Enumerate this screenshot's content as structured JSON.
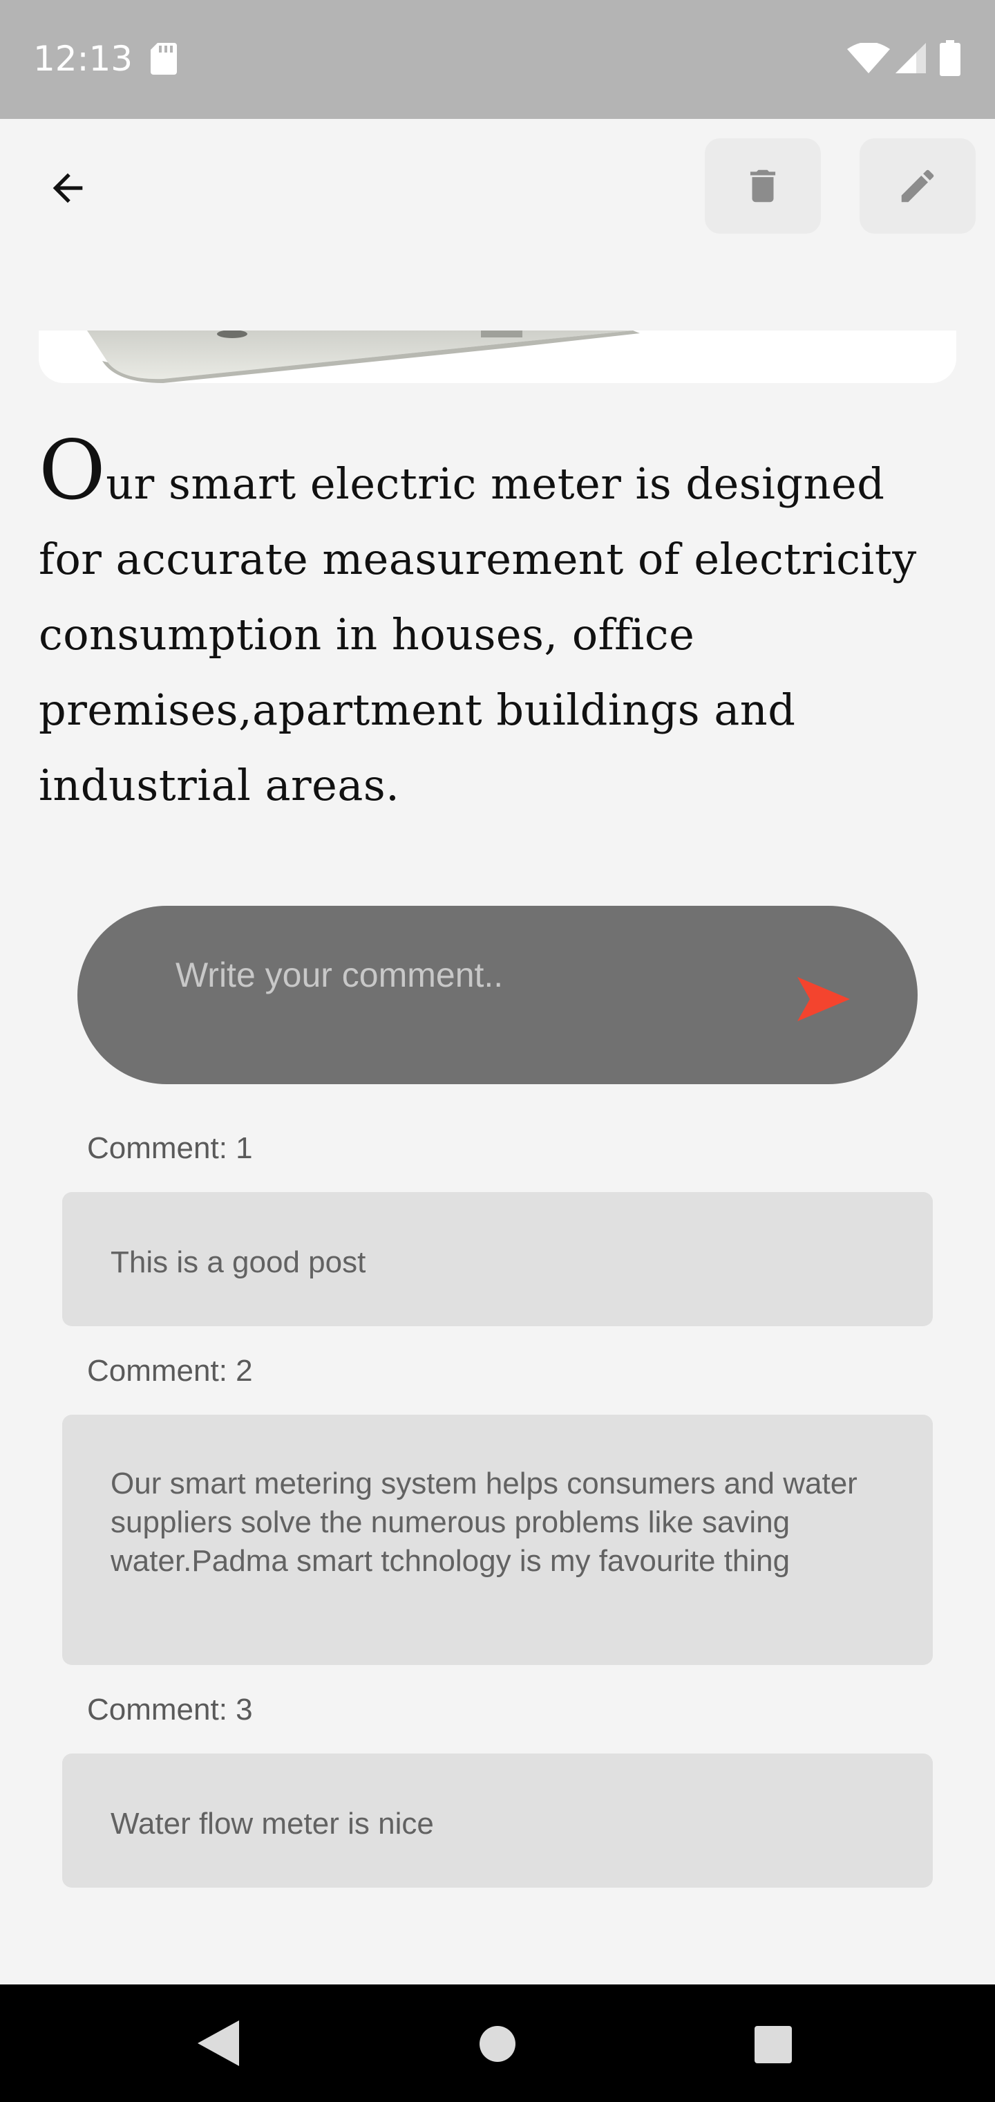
{
  "status_bar": {
    "time": "12:13",
    "icons": [
      "sd-card-icon",
      "wifi-icon",
      "signal-icon",
      "battery-icon"
    ]
  },
  "app_bar": {
    "back_icon": "arrow-back-icon",
    "delete_icon": "trash-icon",
    "edit_icon": "pencil-icon"
  },
  "post": {
    "description_first_letter": "O",
    "description_rest": "ur smart electric meter is designed for accurate measurement of electricity consumption in houses, office premises,apartment buildings and industrial areas."
  },
  "comment_input": {
    "placeholder": "Write your comment..",
    "send_icon": "send-icon"
  },
  "comments": [
    {
      "label": "Comment: 1",
      "text": "This is a good post"
    },
    {
      "label": "Comment: 2",
      "text": "Our smart metering system helps consumers and water suppliers solve the numerous problems like saving water.Padma smart tchnology is my favourite thing"
    },
    {
      "label": "Comment: 3",
      "text": "Water flow meter is nice"
    }
  ],
  "nav_bar": {
    "icons": [
      "nav-back-icon",
      "nav-home-icon",
      "nav-recents-icon"
    ]
  },
  "colors": {
    "send_accent": "#f4442e",
    "input_bg": "#717171",
    "card_bg": "#e0e0e0"
  }
}
